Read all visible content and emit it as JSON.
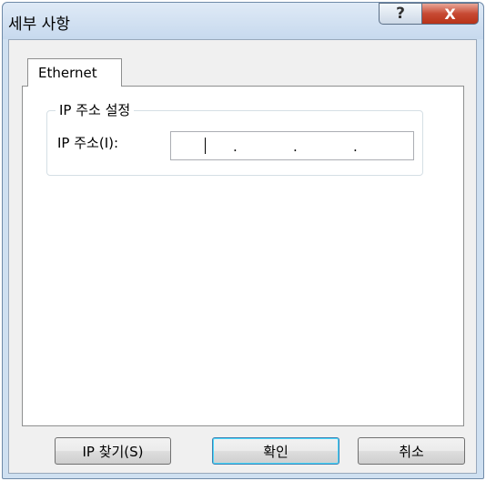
{
  "window": {
    "title": "세부 사항",
    "help_button": "?",
    "close_button": "X"
  },
  "tabs": [
    {
      "label": "Ethernet",
      "selected": true
    }
  ],
  "ip_group": {
    "title": "IP 주소 설정",
    "ip_label": "IP 주소(I):",
    "ip_value": [
      "",
      "",
      "",
      ""
    ],
    "dot": "."
  },
  "buttons": {
    "find_ip": "IP 찾기(S)",
    "ok": "확인",
    "cancel": "취소"
  },
  "colors": {
    "titlebar": "#cfe0f1",
    "close_button": "#c74a33",
    "primary_border": "#3c7fb1"
  }
}
